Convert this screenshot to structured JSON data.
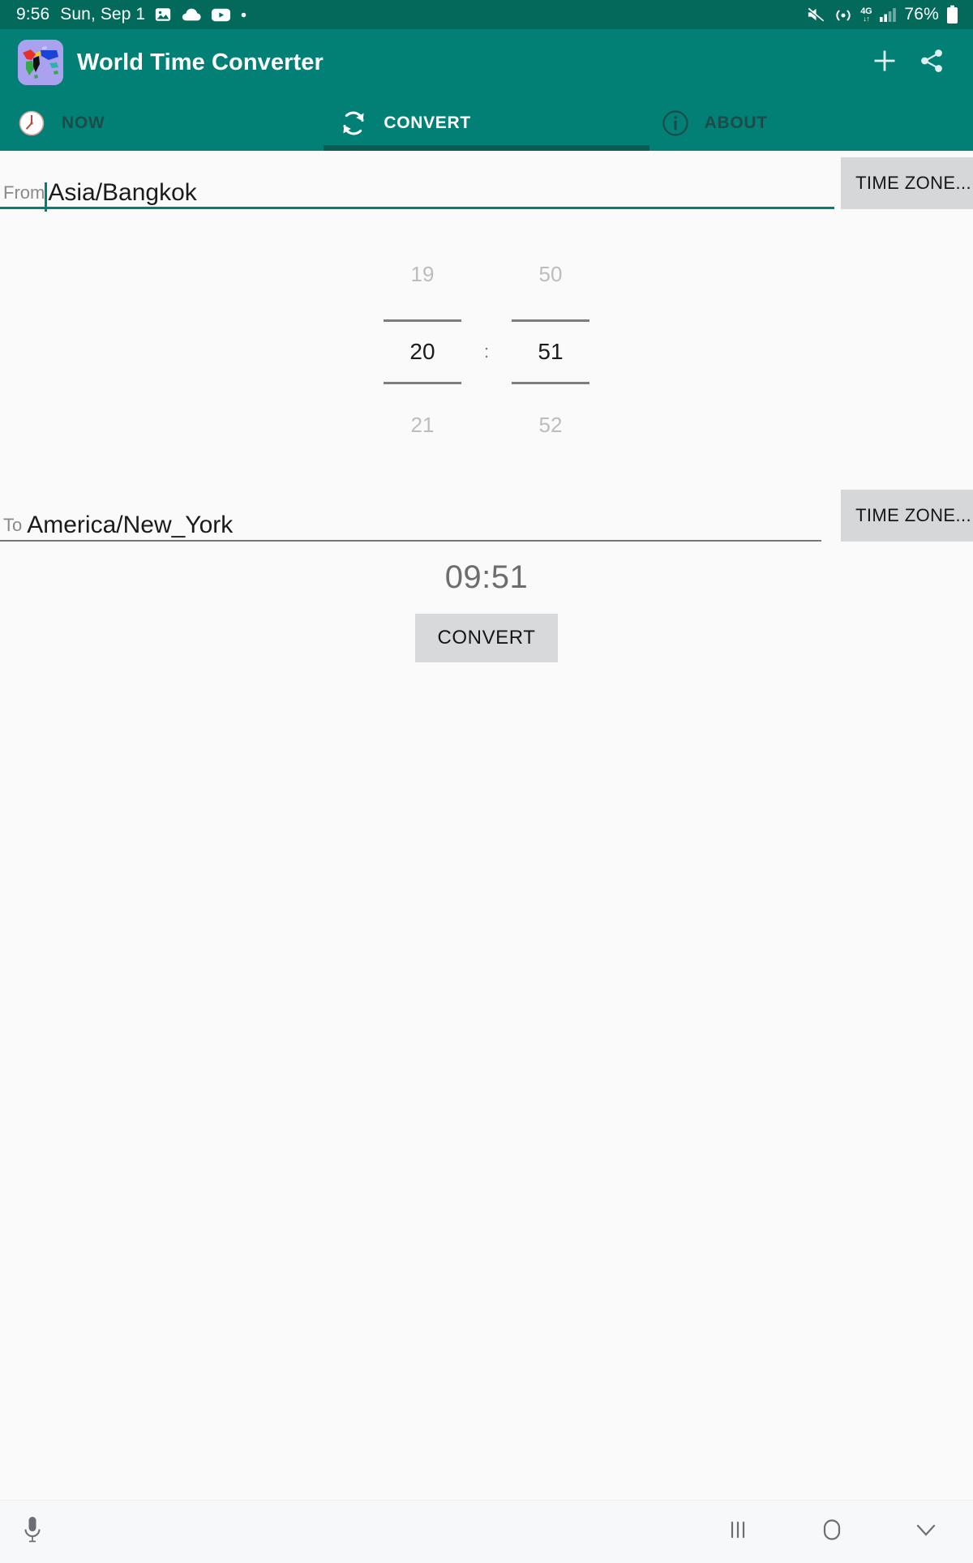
{
  "status_bar": {
    "time": "9:56",
    "date": "Sun, Sep 1",
    "left_icons": [
      "image-icon",
      "cloud-icon",
      "youtube-icon",
      "dot-icon"
    ],
    "right_icons": [
      "mute-icon",
      "hotspot-icon",
      "signal-bars-icon",
      "battery-icon"
    ],
    "network_label": "4G",
    "network_arrows": "↓↑",
    "battery_percent": "76%",
    "background_color": "#03695a"
  },
  "app_bar": {
    "title": "World Time Converter",
    "logo_name": "world-map-app-icon",
    "background_color": "#028075",
    "actions": [
      {
        "name": "add-button",
        "icon": "plus-icon"
      },
      {
        "name": "share-button",
        "icon": "share-icon"
      }
    ]
  },
  "tabs": {
    "indicator_color": "#0a5b52",
    "items": [
      {
        "label": "NOW",
        "icon": "clock-icon",
        "active": false
      },
      {
        "label": "CONVERT",
        "icon": "sync-refresh-icon",
        "active": true
      },
      {
        "label": "ABOUT",
        "icon": "info-circle-icon",
        "active": false
      }
    ]
  },
  "convert_form": {
    "from": {
      "label": "From",
      "value": "Asia/Bangkok",
      "placeholder": "Time zone",
      "focused": true,
      "underline_color": "#028075",
      "timezone_button": "TIME ZONE..."
    },
    "to": {
      "label": "To",
      "value": "America/New_York",
      "placeholder": "Time zone",
      "focused": false,
      "underline_color": "#777777",
      "timezone_button": "TIME ZONE..."
    },
    "time_picker": {
      "hours": {
        "previous": "19",
        "selected": "20",
        "next": "21"
      },
      "separator": ":",
      "minutes": {
        "previous": "50",
        "selected": "51",
        "next": "52"
      }
    },
    "result_time": "09:51",
    "convert_button": "CONVERT"
  },
  "nav_bar": {
    "mic_icon": "microphone-icon",
    "buttons": [
      {
        "name": "recents-button",
        "icon": "recents-icon"
      },
      {
        "name": "home-button",
        "icon": "home-circle-icon"
      },
      {
        "name": "back-button",
        "icon": "chevron-down-icon"
      }
    ]
  }
}
